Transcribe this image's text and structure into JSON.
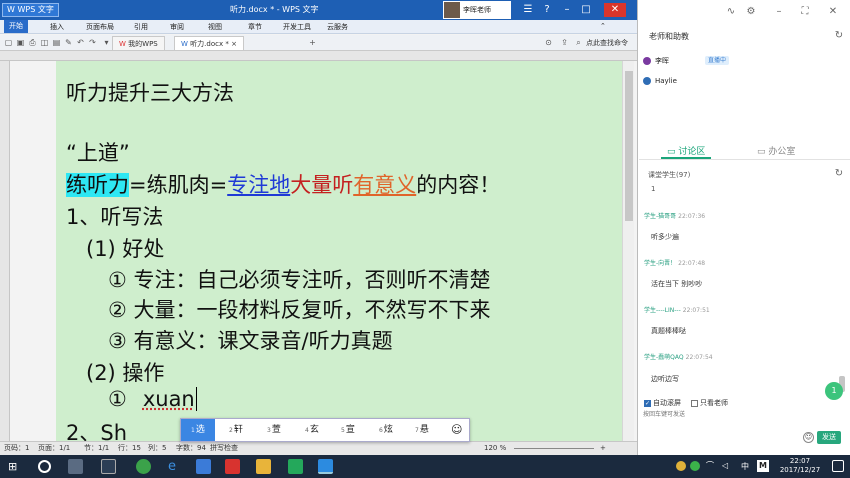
{
  "wps": {
    "app_label": "WPS 文字",
    "title": "听力.docx * - WPS 文字",
    "user": "李晖老师",
    "menus": [
      "开始",
      "插入",
      "页面布局",
      "引用",
      "审阅",
      "视图",
      "章节",
      "开发工具",
      "云服务"
    ],
    "tabs": [
      "我的WPS",
      "听力.docx *"
    ],
    "help": "点此查找命令"
  },
  "document": {
    "heading": "听力提升三大方法",
    "quote": "“上道”",
    "formula": {
      "term": "练听力",
      "eq1": "=练肌肉=",
      "focus": "专注地",
      "massive": "大量听",
      "meaning": "有意义",
      "tail": "的内容！"
    },
    "item1": "1、听写法",
    "sub1": "(1)  好处",
    "b1": "①   专注：自己必须专注听，否则听不清楚",
    "b2": "②   大量：一段材料反复听，不然写不下来",
    "b3": "③   有意义：课文录音/听力真题",
    "sub2": "(2)  操作",
    "op1_num": "①",
    "op1_text": "xuan",
    "partial": "2、Sh"
  },
  "status": {
    "page": "页码：1",
    "pages": "页面：1/1",
    "section": "节：1/1",
    "row": "行：15",
    "col": "列：5",
    "words": "字数：94",
    "spell": "拼写检查",
    "zoom": "120 %"
  },
  "ime": {
    "candidates": [
      {
        "num": "1",
        "text": "选"
      },
      {
        "num": "2",
        "text": "轩"
      },
      {
        "num": "3",
        "text": "萱"
      },
      {
        "num": "4",
        "text": "玄"
      },
      {
        "num": "5",
        "text": "宣"
      },
      {
        "num": "6",
        "text": "炫"
      },
      {
        "num": "7",
        "text": "悬"
      }
    ]
  },
  "panel": {
    "label": "老师和助教",
    "teacher": "李晖",
    "live": "直播中",
    "assistant": "Haylie",
    "tab_discuss": "讨论区",
    "tab_office": "办公室",
    "class_line": "课堂学生(97)",
    "count": "1",
    "messages": [
      {
        "user": "学生-猫哥哥",
        "time": "22:07:36",
        "text": "听多少遍"
      },
      {
        "user": "学生-向晋！",
        "time": "22:07:48",
        "text": "活在当下 别吵吵"
      },
      {
        "user": "学生----LIN---",
        "time": "22:07:51",
        "text": "真题棒棒哒"
      },
      {
        "user": "学生-蠢萌QAQ",
        "time": "22:07:54",
        "text": "边听边写"
      }
    ],
    "badge": "1",
    "autoscroll": "自动滚屏",
    "only_teacher": "只看老师",
    "input_placeholder": "按回车键可发送",
    "send": "发送"
  },
  "taskbar": {
    "lang": "中",
    "ime": "M",
    "time": "22:07",
    "date": "2017/12/27"
  },
  "colors": {
    "wps_blue": "#1e5fb4",
    "page_bg": "#cfeecd",
    "highlight": "#2ee7f3",
    "send_green": "#27a77d"
  }
}
